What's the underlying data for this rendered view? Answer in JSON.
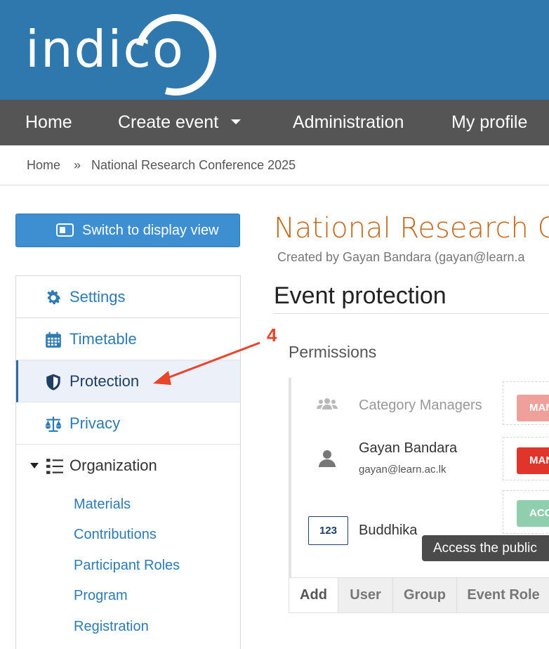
{
  "header": {
    "logo_text": "indico",
    "brand_color": "#2e78ad"
  },
  "nav": {
    "items": [
      {
        "label": "Home"
      },
      {
        "label": "Create event",
        "has_dropdown": true
      },
      {
        "label": "Administration"
      },
      {
        "label": "My profile"
      }
    ]
  },
  "breadcrumb": {
    "items": [
      "Home",
      "National Research Conference 2025"
    ],
    "separator": "»"
  },
  "sidebar": {
    "switch_button": {
      "label": "Switch to display view",
      "icon": "display-view-icon"
    },
    "items": [
      {
        "label": "Settings",
        "icon": "gear-icon"
      },
      {
        "label": "Timetable",
        "icon": "calendar-icon"
      },
      {
        "label": "Protection",
        "icon": "shield-icon",
        "active": true
      },
      {
        "label": "Privacy",
        "icon": "scale-icon"
      },
      {
        "label": "Organization",
        "icon": "list-icon",
        "expanded": true
      }
    ],
    "organization_items": [
      "Materials",
      "Contributions",
      "Participant Roles",
      "Program",
      "Registration"
    ]
  },
  "main": {
    "event_title": "National Research Co",
    "created_by": "Created by Gayan Bandara (gayan@learn.a",
    "section_title": "Event protection",
    "permissions_title": "Permissions",
    "entries": [
      {
        "name": "Category Managers",
        "email": "",
        "badge": "MAN",
        "badge_color": "#f0a09a",
        "icon": "group-icon"
      },
      {
        "name": "Gayan Bandara",
        "email": "gayan@learn.ac.lk",
        "badge": "MAN",
        "badge_color": "#e0352b",
        "icon": "user-icon"
      },
      {
        "name": "Buddhika",
        "email": "",
        "id_label": "123",
        "badge": "ACC",
        "badge_color": "#8fcfae"
      }
    ],
    "tooltip": "Access the public",
    "tabs": [
      "Add",
      "User",
      "Group",
      "Event Role"
    ]
  },
  "annotation": {
    "step_number": "4",
    "color": "#e8452a"
  }
}
